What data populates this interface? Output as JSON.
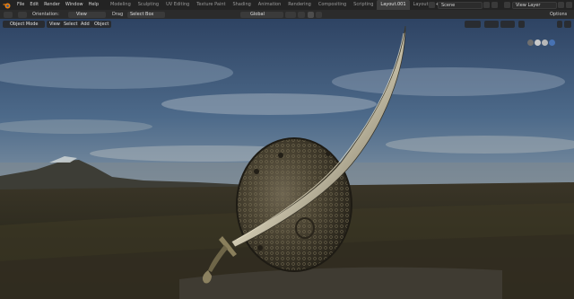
{
  "menu": [
    "File",
    "Edit",
    "Render",
    "Window",
    "Help"
  ],
  "workspaces": [
    "Modeling",
    "Sculpting",
    "UV Editing",
    "Texture Paint",
    "Shading",
    "Animation",
    "Rendering",
    "Compositing",
    "Scripting",
    "Layout.001",
    "Layout"
  ],
  "workspace_plus": "+",
  "scene": "Scene",
  "view_layer": "View Layer",
  "tool_header": {
    "orientation_label": "Orientation:",
    "orientation_value": "View",
    "drag_label": "Drag",
    "drag_value": "Select Box",
    "transform_space": "Global",
    "options": "Options"
  },
  "viewport_header": {
    "mode": "Object Mode",
    "view": "View",
    "select": "Select",
    "add": "Add",
    "object": "Object"
  },
  "colors": {
    "accent": "#4772b3",
    "bg": "#1d1d1d"
  }
}
